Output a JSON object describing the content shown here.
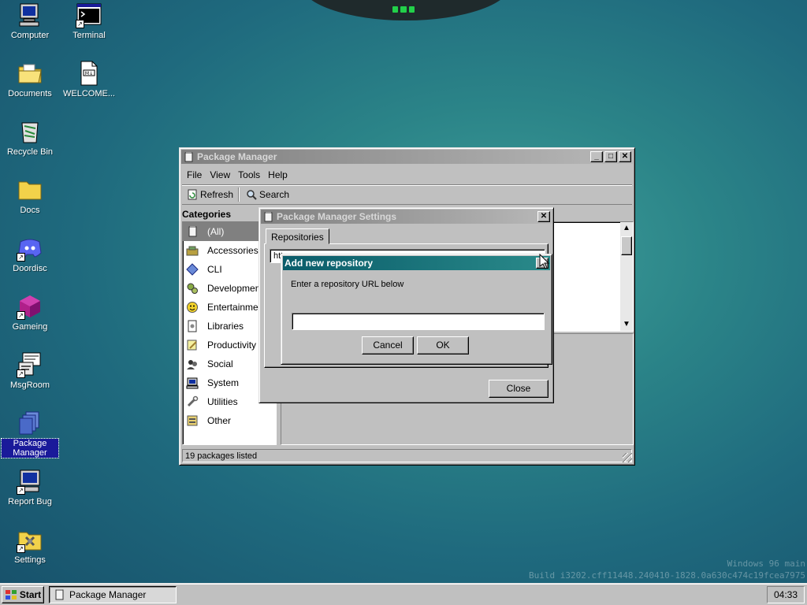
{
  "desktop": {
    "icons": [
      {
        "label": "Computer",
        "icon": "computer-icon"
      },
      {
        "label": "Terminal",
        "icon": "terminal-icon"
      },
      {
        "label": "Documents",
        "icon": "documents-folder-icon"
      },
      {
        "label": "WELCOME...",
        "icon": "markdown-file-icon"
      },
      {
        "label": "Recycle Bin",
        "icon": "recycle-bin-icon"
      },
      {
        "label": "Docs",
        "icon": "folder-icon"
      },
      {
        "label": "Doordisc",
        "icon": "doordisc-icon"
      },
      {
        "label": "Gameing",
        "icon": "cube-icon"
      },
      {
        "label": "MsgRoom",
        "icon": "msgroom-icon"
      },
      {
        "label": "Package Manager",
        "icon": "package-manager-icon"
      },
      {
        "label": "Report Bug",
        "icon": "report-bug-icon"
      },
      {
        "label": "Settings",
        "icon": "settings-icon"
      }
    ],
    "watermark": [
      "Windows 96 main",
      "Build i3202.cff11448.240410-1828.0a630c474c19fcea7975"
    ]
  },
  "package_manager": {
    "title": "Package Manager",
    "menu": [
      "File",
      "View",
      "Tools",
      "Help"
    ],
    "toolbar": {
      "refresh": "Refresh",
      "search": "Search"
    },
    "categories_header": "Categories",
    "categories": [
      {
        "label": "(All)",
        "icon": "all-packages-icon",
        "selected": true
      },
      {
        "label": "Accessories",
        "icon": "accessories-icon"
      },
      {
        "label": "CLI",
        "icon": "cli-icon"
      },
      {
        "label": "Development",
        "icon": "development-icon"
      },
      {
        "label": "Entertainment",
        "icon": "entertainment-icon"
      },
      {
        "label": "Libraries",
        "icon": "libraries-icon"
      },
      {
        "label": "Productivity",
        "icon": "productivity-icon"
      },
      {
        "label": "Social",
        "icon": "social-icon"
      },
      {
        "label": "System",
        "icon": "system-icon"
      },
      {
        "label": "Utilities",
        "icon": "utilities-icon"
      },
      {
        "label": "Other",
        "icon": "other-icon"
      }
    ],
    "status": "19 packages listed"
  },
  "settings_dialog": {
    "title": "Package Manager Settings",
    "tab": "Repositories",
    "repo_row": "htt",
    "close_button": "Close"
  },
  "add_repo_dialog": {
    "title": "Add new repository",
    "prompt": "Enter a repository URL below",
    "url_value": "",
    "cancel": "Cancel",
    "ok": "OK"
  },
  "taskbar": {
    "start": "Start",
    "task": "Package Manager",
    "clock": "04:33"
  },
  "colors": {
    "desktop": "#2b8488",
    "window_face": "#c0c0c0",
    "active_title": "#0a5c6a",
    "selection": "#808080"
  }
}
